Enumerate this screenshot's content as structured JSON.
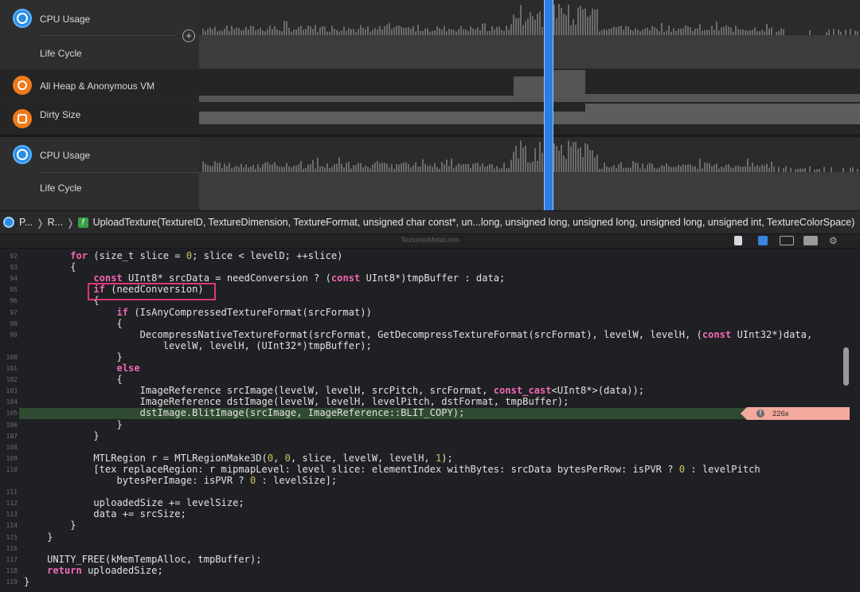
{
  "instruments": {
    "tracks": [
      {
        "name": "CPU Usage",
        "icon": "cpu-gauge-icon",
        "color": "#2a8ee6"
      },
      {
        "name": "Life Cycle"
      },
      {
        "name": "All Heap & Anonymous VM",
        "icon": "memory-icon",
        "color": "#ef7a1a"
      },
      {
        "name": "Dirty Size",
        "icon": "vm-tracker-icon",
        "color": "#ef7a1a"
      },
      {
        "name": "CPU Usage",
        "icon": "cpu-gauge-icon",
        "color": "#2a8ee6"
      },
      {
        "name": "Life Cycle"
      }
    ],
    "add_symbol": "+"
  },
  "jumpbar": {
    "crumb1": "P...",
    "crumb2": "R...",
    "function": "UploadTexture(TextureID, TextureDimension, TextureFormat, unsigned char const*, un...long, unsigned long, unsigned long, unsigned long, unsigned int, TextureColorSpace)"
  },
  "editor": {
    "filename": "TexturesMetal.mm"
  },
  "code": {
    "lines": [
      {
        "n": "92",
        "segs": [
          [
            "        ",
            ""
          ],
          [
            "for",
            "kw"
          ],
          [
            " (size_t slice = ",
            ""
          ],
          [
            "0",
            "num"
          ],
          [
            "; slice < levelD; ++slice)",
            ""
          ]
        ]
      },
      {
        "n": "93",
        "segs": [
          [
            "        {",
            ""
          ]
        ]
      },
      {
        "n": "94",
        "segs": [
          [
            "            ",
            ""
          ],
          [
            "const",
            "kw"
          ],
          [
            " UInt8* srcData = needConversion ? (",
            ""
          ],
          [
            "const",
            "kw"
          ],
          [
            " UInt8*)tmpBuffer : data;",
            ""
          ]
        ]
      },
      {
        "n": "95",
        "segs": [
          [
            "            ",
            ""
          ],
          [
            "if",
            "kw"
          ],
          [
            " (needConversion)",
            ""
          ]
        ]
      },
      {
        "n": "96",
        "segs": [
          [
            "            {",
            ""
          ]
        ]
      },
      {
        "n": "97",
        "segs": [
          [
            "                ",
            ""
          ],
          [
            "if",
            "kw"
          ],
          [
            " (IsAnyCompressedTextureFormat(srcFormat))",
            ""
          ]
        ]
      },
      {
        "n": "98",
        "segs": [
          [
            "                {",
            ""
          ]
        ]
      },
      {
        "n": "99",
        "segs": [
          [
            "                    DecompressNativeTextureFormat(srcFormat, GetDecompressTextureFormat(srcFormat), levelW, levelH, (",
            ""
          ],
          [
            "const",
            "kw"
          ],
          [
            " UInt32*)data,",
            ""
          ]
        ]
      },
      {
        "n": "",
        "segs": [
          [
            "                        levelW, levelH, (UInt32*)tmpBuffer);",
            ""
          ]
        ]
      },
      {
        "n": "100",
        "segs": [
          [
            "                }",
            ""
          ]
        ]
      },
      {
        "n": "101",
        "segs": [
          [
            "                ",
            ""
          ],
          [
            "else",
            "kw"
          ]
        ]
      },
      {
        "n": "102",
        "segs": [
          [
            "                {",
            ""
          ]
        ]
      },
      {
        "n": "103",
        "segs": [
          [
            "                    ImageReference srcImage(levelW, levelH, srcPitch, srcFormat, ",
            ""
          ],
          [
            "const_cast",
            "kw"
          ],
          [
            "<UInt8*>(data));",
            ""
          ]
        ]
      },
      {
        "n": "104",
        "segs": [
          [
            "                    ImageReference dstImage(levelW, levelH, levelPitch, dstFormat, tmpBuffer);",
            ""
          ]
        ]
      },
      {
        "n": "105",
        "segs": [
          [
            "                    dstImage.BlitImage(srcImage, ImageReference::BLIT_COPY);",
            ""
          ]
        ]
      },
      {
        "n": "106",
        "segs": [
          [
            "                }",
            ""
          ]
        ]
      },
      {
        "n": "107",
        "segs": [
          [
            "            }",
            ""
          ]
        ]
      },
      {
        "n": "108",
        "segs": [
          [
            "",
            ""
          ]
        ]
      },
      {
        "n": "109",
        "segs": [
          [
            "            MTLRegion r = MTLRegionMake3D(",
            ""
          ],
          [
            "0",
            "num"
          ],
          [
            ", ",
            ""
          ],
          [
            "0",
            "num"
          ],
          [
            ", slice, levelW, levelH, ",
            ""
          ],
          [
            "1",
            "num"
          ],
          [
            ");",
            ""
          ]
        ]
      },
      {
        "n": "110",
        "segs": [
          [
            "            [tex replaceRegion: r mipmapLevel: level slice: elementIndex withBytes: srcData bytesPerRow: isPVR ? ",
            ""
          ],
          [
            "0",
            "num"
          ],
          [
            " : levelPitch",
            ""
          ]
        ]
      },
      {
        "n": "",
        "segs": [
          [
            "                bytesPerImage: isPVR ? ",
            ""
          ],
          [
            "0",
            "num"
          ],
          [
            " : levelSize];",
            ""
          ]
        ]
      },
      {
        "n": "111",
        "segs": [
          [
            "",
            ""
          ]
        ]
      },
      {
        "n": "112",
        "segs": [
          [
            "            uploadedSize += levelSize;",
            ""
          ]
        ]
      },
      {
        "n": "113",
        "segs": [
          [
            "            data += srcSize;",
            ""
          ]
        ]
      },
      {
        "n": "114",
        "segs": [
          [
            "        }",
            ""
          ]
        ]
      },
      {
        "n": "115",
        "segs": [
          [
            "    }",
            ""
          ]
        ]
      },
      {
        "n": "116",
        "segs": [
          [
            "",
            ""
          ]
        ]
      },
      {
        "n": "117",
        "segs": [
          [
            "    UNITY_FREE(kMemTempAlloc, tmpBuffer);",
            ""
          ]
        ]
      },
      {
        "n": "118",
        "segs": [
          [
            "    ",
            ""
          ],
          [
            "return",
            "kw"
          ],
          [
            " uploadedSize;",
            ""
          ]
        ]
      },
      {
        "n": "119",
        "segs": [
          [
            "}",
            ""
          ]
        ]
      }
    ],
    "highlight_line": "105",
    "issue_icon_glyph": "!",
    "issue_count": "226x"
  },
  "colors": {
    "keyword": "#f267b5",
    "number": "#d3c35f",
    "highlight_row": "#2f4a31",
    "issue_bg": "#f3a99d",
    "annotation_box": "#e0357a",
    "cpu_fill": "#6b6b6b",
    "selection": "#2a7de1",
    "dirty_green": "#3fd04a"
  }
}
